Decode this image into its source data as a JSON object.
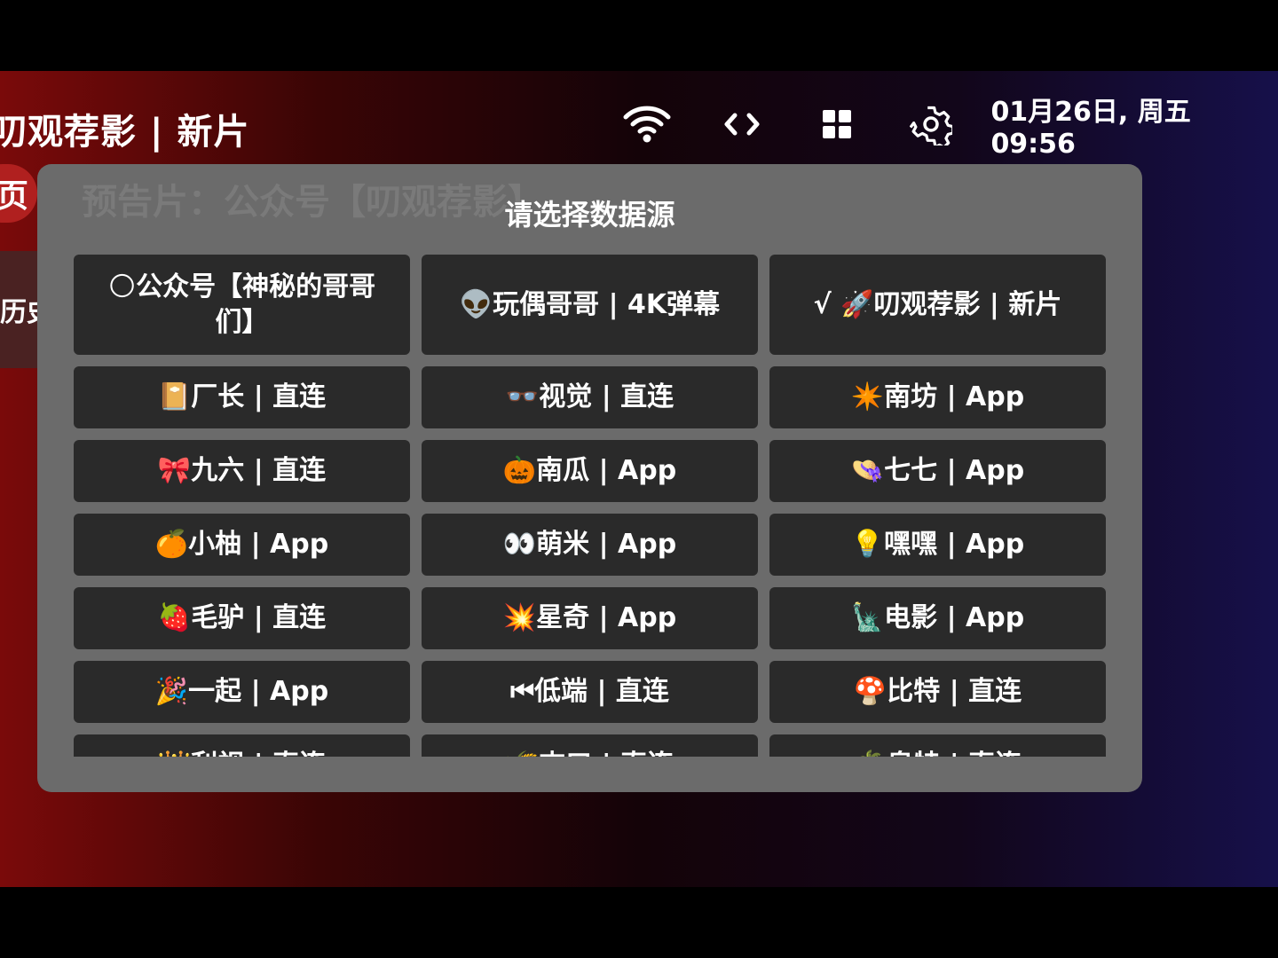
{
  "header": {
    "title": "叨观荐影 | 新片",
    "datetime": "01月26日, 周五 09:56",
    "icons": [
      "wifi-icon",
      "code-icon",
      "grid-icon",
      "gear-icon"
    ]
  },
  "sidebar": {
    "active_label": "页",
    "history_label": "历史"
  },
  "background": {
    "ghost_text": "预告片：公众号【叨观荐影】"
  },
  "dialog": {
    "title": "请选择数据源",
    "options": [
      {
        "label": "🌕公众号【神秘的哥哥们】"
      },
      {
        "label": "👽玩偶哥哥 | 4K弹幕"
      },
      {
        "label": "√ 🚀叨观荐影 | 新片",
        "selected": true
      },
      {
        "label": "📔厂长 | 直连"
      },
      {
        "label": "👓视觉 | 直连"
      },
      {
        "label": "✴️南坊 | App"
      },
      {
        "label": "🎀九六 | 直连"
      },
      {
        "label": "🎃南瓜 | App"
      },
      {
        "label": "👒七七 | App"
      },
      {
        "label": "🍊小柚 | App"
      },
      {
        "label": "👀萌米 | App"
      },
      {
        "label": "💡嘿嘿 | App"
      },
      {
        "label": "🍓毛驴 | 直连"
      },
      {
        "label": "💥星奇 | App"
      },
      {
        "label": "🗽电影 | App"
      },
      {
        "label": "🎉一起 | App"
      },
      {
        "label": "⏮低端 | 直连"
      },
      {
        "label": "🍄比特 | 直连"
      },
      {
        "label": "👑利视 | 直连"
      },
      {
        "label": "🌾吉口 | 直连"
      },
      {
        "label": "🌴皇特 | 直连"
      }
    ]
  }
}
